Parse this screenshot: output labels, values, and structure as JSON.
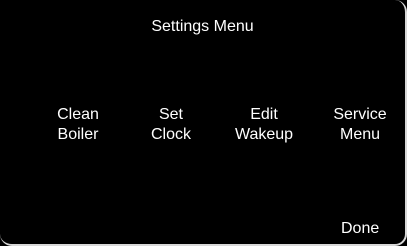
{
  "header": {
    "title": "Settings Menu"
  },
  "menu": {
    "items": [
      {
        "line1": "Clean",
        "line2": "Boiler"
      },
      {
        "line1": "Set",
        "line2": "Clock"
      },
      {
        "line1": "Edit",
        "line2": "Wakeup"
      },
      {
        "line1": "Service",
        "line2": "Menu"
      }
    ]
  },
  "footer": {
    "done_label": "Done"
  },
  "colors": {
    "background": "#000000",
    "text": "#ffffff"
  }
}
